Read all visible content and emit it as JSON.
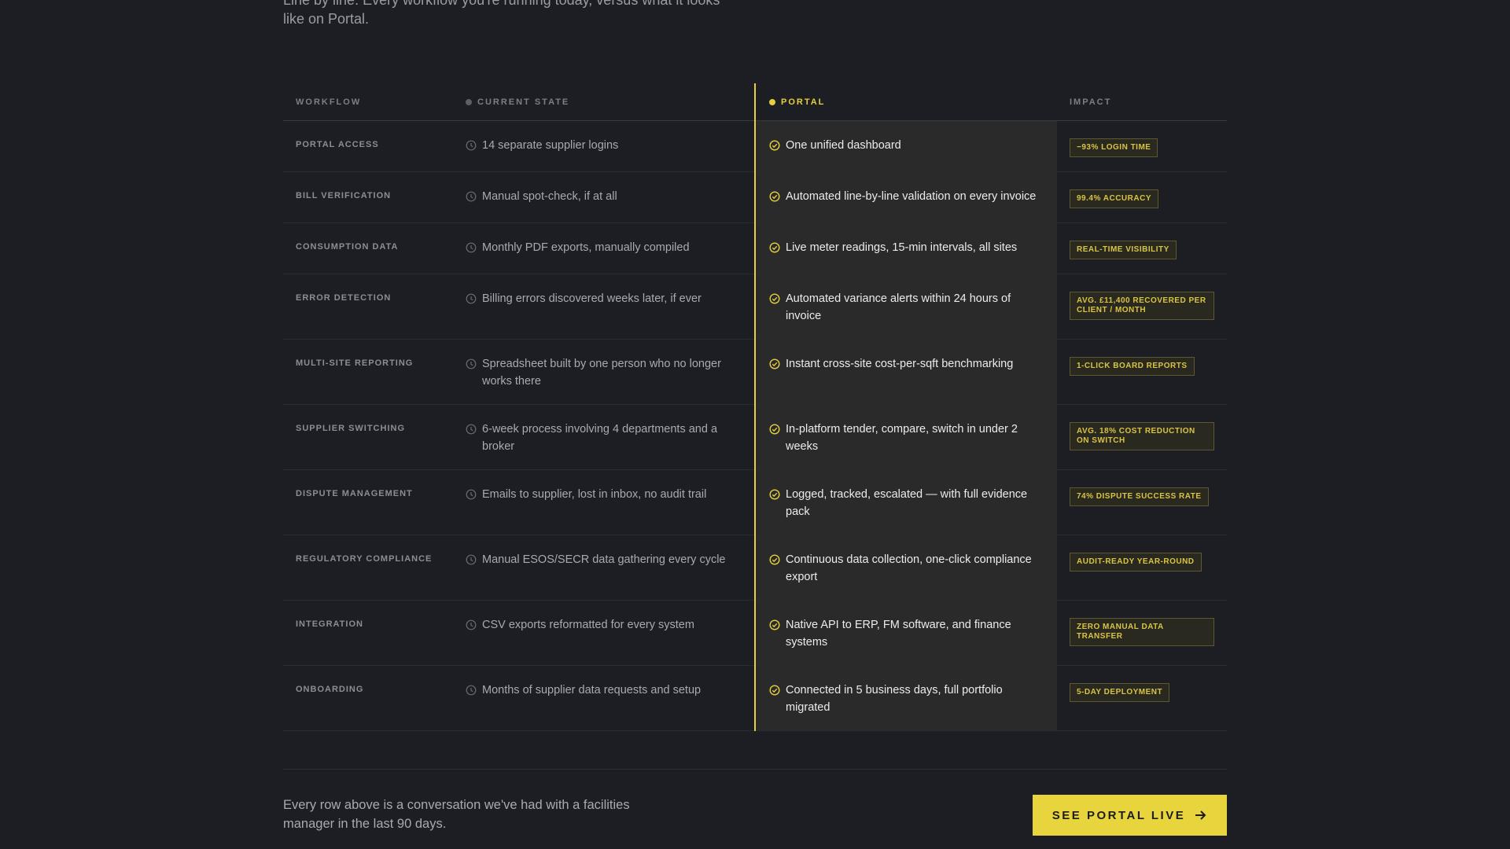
{
  "intro_text": "Line by line. Every workflow you're running today, versus what it looks like on Portal.",
  "headers": {
    "workflow": "WORKFLOW",
    "current": "CURRENT STATE",
    "portal": "PORTAL",
    "impact": "IMPACT"
  },
  "colors": {
    "accent": "#e5cf3f",
    "background": "#1d1e24",
    "portal_column": "#2a2a2b"
  },
  "icons": {
    "current": "clock-icon",
    "portal": "check-circle-icon",
    "cta": "arrow-right-icon"
  },
  "rows": [
    {
      "workflow": "PORTAL ACCESS",
      "current": "14 separate supplier logins",
      "portal": "One unified dashboard",
      "impact": "−93% LOGIN TIME"
    },
    {
      "workflow": "BILL VERIFICATION",
      "current": "Manual spot-check, if at all",
      "portal": "Automated line-by-line validation on every invoice",
      "impact": "99.4% ACCURACY"
    },
    {
      "workflow": "CONSUMPTION DATA",
      "current": "Monthly PDF exports, manually compiled",
      "portal": "Live meter readings, 15-min intervals, all sites",
      "impact": "REAL-TIME VISIBILITY"
    },
    {
      "workflow": "ERROR DETECTION",
      "current": "Billing errors discovered weeks later, if ever",
      "portal": "Automated variance alerts within 24 hours of invoice",
      "impact": "AVG. £11,400 RECOVERED PER CLIENT / MONTH"
    },
    {
      "workflow": "MULTI-SITE REPORTING",
      "current": "Spreadsheet built by one person who no longer works there",
      "portal": "Instant cross-site cost-per-sqft benchmarking",
      "impact": "1-CLICK BOARD REPORTS"
    },
    {
      "workflow": "SUPPLIER SWITCHING",
      "current": "6-week process involving 4 departments and a broker",
      "portal": "In-platform tender, compare, switch in under 2 weeks",
      "impact": "AVG. 18% COST REDUCTION ON SWITCH"
    },
    {
      "workflow": "DISPUTE MANAGEMENT",
      "current": "Emails to supplier, lost in inbox, no audit trail",
      "portal": "Logged, tracked, escalated — with full evidence pack",
      "impact": "74% DISPUTE SUCCESS RATE"
    },
    {
      "workflow": "REGULATORY COMPLIANCE",
      "current": "Manual ESOS/SECR data gathering every cycle",
      "portal": "Continuous data collection, one-click compliance export",
      "impact": "AUDIT-READY YEAR-ROUND"
    },
    {
      "workflow": "INTEGRATION",
      "current": "CSV exports reformatted for every system",
      "portal": "Native API to ERP, FM software, and finance systems",
      "impact": "ZERO MANUAL DATA TRANSFER"
    },
    {
      "workflow": "ONBOARDING",
      "current": "Months of supplier data requests and setup",
      "portal": "Connected in 5 business days, full portfolio migrated",
      "impact": "5-DAY DEPLOYMENT"
    }
  ],
  "footer": {
    "text": "Every row above is a conversation we've had with a facilities manager in the last 90 days.",
    "cta_label": "SEE PORTAL LIVE"
  }
}
